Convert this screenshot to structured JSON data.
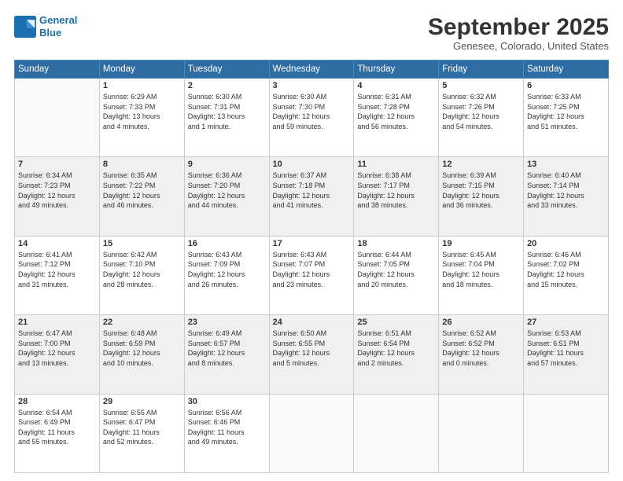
{
  "logo": {
    "line1": "General",
    "line2": "Blue"
  },
  "title": "September 2025",
  "subtitle": "Genesee, Colorado, United States",
  "days_header": [
    "Sunday",
    "Monday",
    "Tuesday",
    "Wednesday",
    "Thursday",
    "Friday",
    "Saturday"
  ],
  "weeks": [
    [
      {
        "num": "",
        "info": ""
      },
      {
        "num": "1",
        "info": "Sunrise: 6:29 AM\nSunset: 7:33 PM\nDaylight: 13 hours\nand 4 minutes."
      },
      {
        "num": "2",
        "info": "Sunrise: 6:30 AM\nSunset: 7:31 PM\nDaylight: 13 hours\nand 1 minute."
      },
      {
        "num": "3",
        "info": "Sunrise: 6:30 AM\nSunset: 7:30 PM\nDaylight: 12 hours\nand 59 minutes."
      },
      {
        "num": "4",
        "info": "Sunrise: 6:31 AM\nSunset: 7:28 PM\nDaylight: 12 hours\nand 56 minutes."
      },
      {
        "num": "5",
        "info": "Sunrise: 6:32 AM\nSunset: 7:26 PM\nDaylight: 12 hours\nand 54 minutes."
      },
      {
        "num": "6",
        "info": "Sunrise: 6:33 AM\nSunset: 7:25 PM\nDaylight: 12 hours\nand 51 minutes."
      }
    ],
    [
      {
        "num": "7",
        "info": "Sunrise: 6:34 AM\nSunset: 7:23 PM\nDaylight: 12 hours\nand 49 minutes."
      },
      {
        "num": "8",
        "info": "Sunrise: 6:35 AM\nSunset: 7:22 PM\nDaylight: 12 hours\nand 46 minutes."
      },
      {
        "num": "9",
        "info": "Sunrise: 6:36 AM\nSunset: 7:20 PM\nDaylight: 12 hours\nand 44 minutes."
      },
      {
        "num": "10",
        "info": "Sunrise: 6:37 AM\nSunset: 7:18 PM\nDaylight: 12 hours\nand 41 minutes."
      },
      {
        "num": "11",
        "info": "Sunrise: 6:38 AM\nSunset: 7:17 PM\nDaylight: 12 hours\nand 38 minutes."
      },
      {
        "num": "12",
        "info": "Sunrise: 6:39 AM\nSunset: 7:15 PM\nDaylight: 12 hours\nand 36 minutes."
      },
      {
        "num": "13",
        "info": "Sunrise: 6:40 AM\nSunset: 7:14 PM\nDaylight: 12 hours\nand 33 minutes."
      }
    ],
    [
      {
        "num": "14",
        "info": "Sunrise: 6:41 AM\nSunset: 7:12 PM\nDaylight: 12 hours\nand 31 minutes."
      },
      {
        "num": "15",
        "info": "Sunrise: 6:42 AM\nSunset: 7:10 PM\nDaylight: 12 hours\nand 28 minutes."
      },
      {
        "num": "16",
        "info": "Sunrise: 6:43 AM\nSunset: 7:09 PM\nDaylight: 12 hours\nand 26 minutes."
      },
      {
        "num": "17",
        "info": "Sunrise: 6:43 AM\nSunset: 7:07 PM\nDaylight: 12 hours\nand 23 minutes."
      },
      {
        "num": "18",
        "info": "Sunrise: 6:44 AM\nSunset: 7:05 PM\nDaylight: 12 hours\nand 20 minutes."
      },
      {
        "num": "19",
        "info": "Sunrise: 6:45 AM\nSunset: 7:04 PM\nDaylight: 12 hours\nand 18 minutes."
      },
      {
        "num": "20",
        "info": "Sunrise: 6:46 AM\nSunset: 7:02 PM\nDaylight: 12 hours\nand 15 minutes."
      }
    ],
    [
      {
        "num": "21",
        "info": "Sunrise: 6:47 AM\nSunset: 7:00 PM\nDaylight: 12 hours\nand 13 minutes."
      },
      {
        "num": "22",
        "info": "Sunrise: 6:48 AM\nSunset: 6:59 PM\nDaylight: 12 hours\nand 10 minutes."
      },
      {
        "num": "23",
        "info": "Sunrise: 6:49 AM\nSunset: 6:57 PM\nDaylight: 12 hours\nand 8 minutes."
      },
      {
        "num": "24",
        "info": "Sunrise: 6:50 AM\nSunset: 6:55 PM\nDaylight: 12 hours\nand 5 minutes."
      },
      {
        "num": "25",
        "info": "Sunrise: 6:51 AM\nSunset: 6:54 PM\nDaylight: 12 hours\nand 2 minutes."
      },
      {
        "num": "26",
        "info": "Sunrise: 6:52 AM\nSunset: 6:52 PM\nDaylight: 12 hours\nand 0 minutes."
      },
      {
        "num": "27",
        "info": "Sunrise: 6:53 AM\nSunset: 6:51 PM\nDaylight: 11 hours\nand 57 minutes."
      }
    ],
    [
      {
        "num": "28",
        "info": "Sunrise: 6:54 AM\nSunset: 6:49 PM\nDaylight: 11 hours\nand 55 minutes."
      },
      {
        "num": "29",
        "info": "Sunrise: 6:55 AM\nSunset: 6:47 PM\nDaylight: 11 hours\nand 52 minutes."
      },
      {
        "num": "30",
        "info": "Sunrise: 6:56 AM\nSunset: 6:46 PM\nDaylight: 11 hours\nand 49 minutes."
      },
      {
        "num": "",
        "info": ""
      },
      {
        "num": "",
        "info": ""
      },
      {
        "num": "",
        "info": ""
      },
      {
        "num": "",
        "info": ""
      }
    ]
  ]
}
